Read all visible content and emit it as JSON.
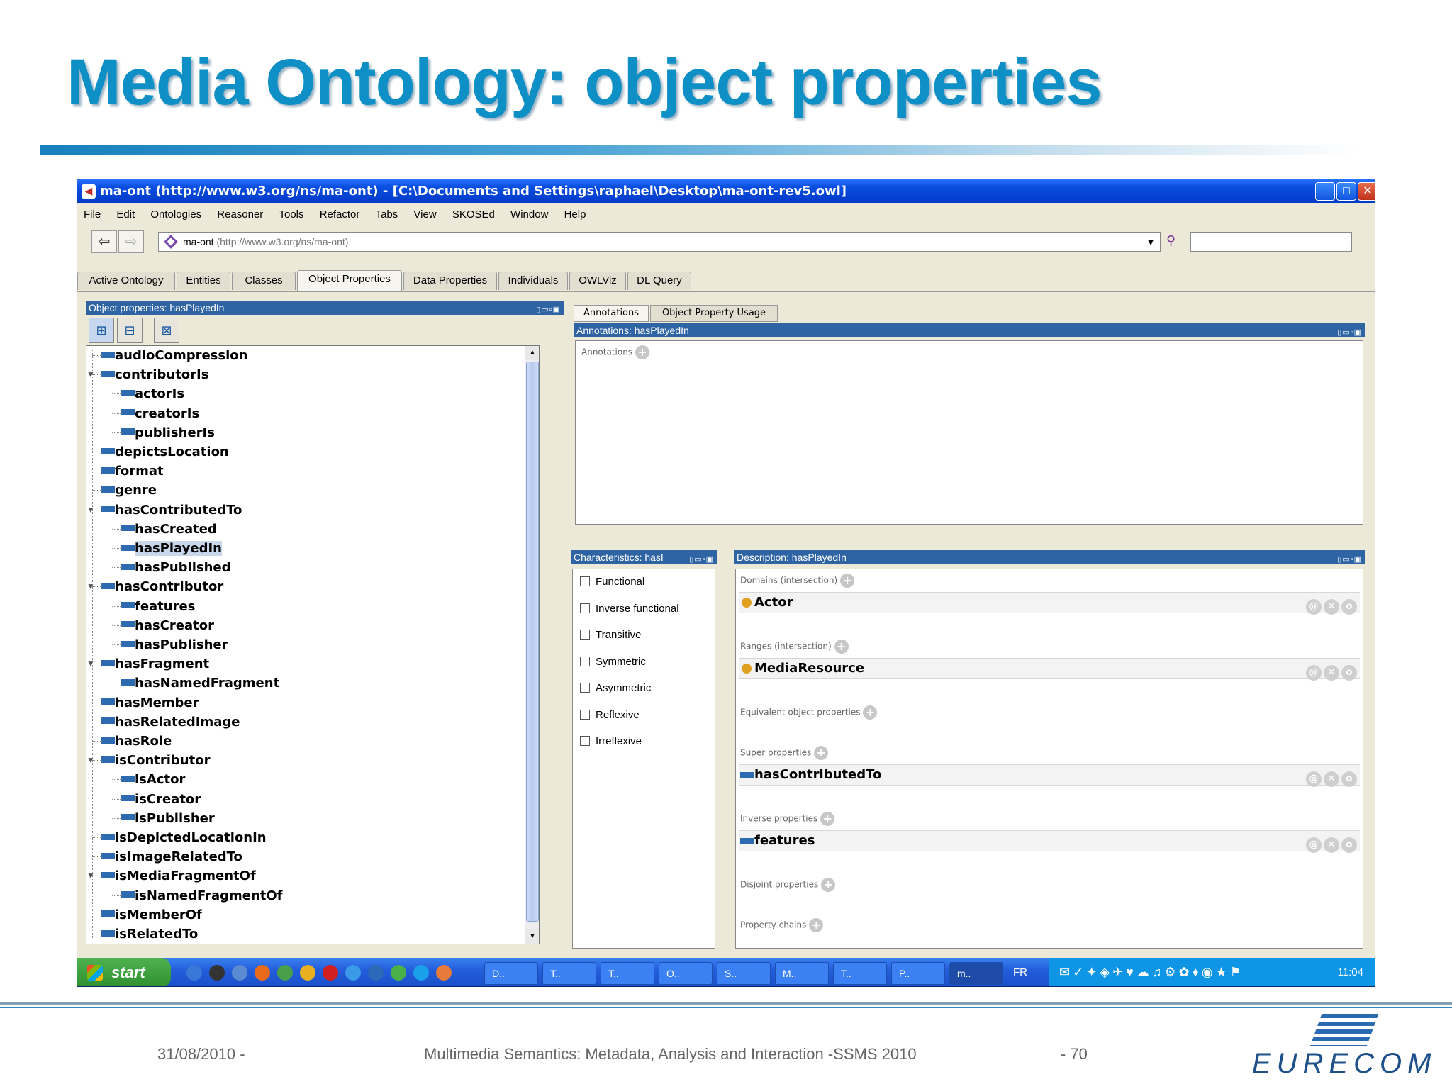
{
  "slide": {
    "title": "Media Ontology: object properties",
    "footer_date": "31/08/2010 -",
    "footer_center": "Multimedia Semantics: Metadata, Analysis and Interaction -SSMS 2010",
    "footer_page": "- 70",
    "logo_text": "EURECOM"
  },
  "window": {
    "title": "ma-ont (http://www.w3.org/ns/ma-ont) - [C:\\Documents and Settings\\raphael\\Desktop\\ma-ont-rev5.owl]"
  },
  "menu": [
    "File",
    "Edit",
    "Ontologies",
    "Reasoner",
    "Tools",
    "Refactor",
    "Tabs",
    "View",
    "SKOSEd",
    "Window",
    "Help"
  ],
  "nav": {
    "ontology_name": "ma-ont",
    "ontology_uri": "(http://www.w3.org/ns/ma-ont)"
  },
  "tabs": [
    "Active Ontology",
    "Entities",
    "Classes",
    "Object Properties",
    "Data Properties",
    "Individuals",
    "OWLViz",
    "DL Query"
  ],
  "active_tab": "Object Properties",
  "left_view": {
    "header": "Object properties: hasPlayedIn",
    "tree": [
      {
        "label": "audioCompression",
        "depth": 0,
        "expanded": false
      },
      {
        "label": "contributorIs",
        "depth": 0,
        "expanded": true
      },
      {
        "label": "actorIs",
        "depth": 1
      },
      {
        "label": "creatorIs",
        "depth": 1
      },
      {
        "label": "publisherIs",
        "depth": 1
      },
      {
        "label": "depictsLocation",
        "depth": 0
      },
      {
        "label": "format",
        "depth": 0
      },
      {
        "label": "genre",
        "depth": 0
      },
      {
        "label": "hasContributedTo",
        "depth": 0,
        "expanded": true
      },
      {
        "label": "hasCreated",
        "depth": 1
      },
      {
        "label": "hasPlayedIn",
        "depth": 1,
        "selected": true
      },
      {
        "label": "hasPublished",
        "depth": 1
      },
      {
        "label": "hasContributor",
        "depth": 0,
        "expanded": true
      },
      {
        "label": "features",
        "depth": 1
      },
      {
        "label": "hasCreator",
        "depth": 1
      },
      {
        "label": "hasPublisher",
        "depth": 1
      },
      {
        "label": "hasFragment",
        "depth": 0,
        "expanded": true
      },
      {
        "label": "hasNamedFragment",
        "depth": 1
      },
      {
        "label": "hasMember",
        "depth": 0
      },
      {
        "label": "hasRelatedImage",
        "depth": 0
      },
      {
        "label": "hasRole",
        "depth": 0
      },
      {
        "label": "isContributor",
        "depth": 0,
        "expanded": true
      },
      {
        "label": "isActor",
        "depth": 1
      },
      {
        "label": "isCreator",
        "depth": 1
      },
      {
        "label": "isPublisher",
        "depth": 1
      },
      {
        "label": "isDepictedLocationIn",
        "depth": 0
      },
      {
        "label": "isImageRelatedTo",
        "depth": 0
      },
      {
        "label": "isMediaFragmentOf",
        "depth": 0,
        "expanded": true
      },
      {
        "label": "isNamedFragmentOf",
        "depth": 1
      },
      {
        "label": "isMemberOf",
        "depth": 0
      },
      {
        "label": "isRelatedTo",
        "depth": 0
      }
    ]
  },
  "right_tabs": [
    "Annotations",
    "Object Property Usage"
  ],
  "annotations_view": {
    "header": "Annotations: hasPlayedIn",
    "section_label": "Annotations"
  },
  "characteristics_view": {
    "header": "Characteristics: hasI",
    "items": [
      "Functional",
      "Inverse functional",
      "Transitive",
      "Symmetric",
      "Asymmetric",
      "Reflexive",
      "Irreflexive"
    ]
  },
  "description_view": {
    "header": "Description: hasPlayedIn",
    "domains_label": "Domains (intersection)",
    "domain_value": "Actor",
    "ranges_label": "Ranges (intersection)",
    "range_value": "MediaResource",
    "equivalent_label": "Equivalent object properties",
    "super_label": "Super properties",
    "super_value": "hasContributedTo",
    "inverse_label": "Inverse properties",
    "inverse_value": "features",
    "disjoint_label": "Disjoint properties",
    "chains_label": "Property chains"
  },
  "taskbar": {
    "start_label": "start",
    "items": [
      "D..",
      "T..",
      "T..",
      "O..",
      "S..",
      "M..",
      "T..",
      "P..",
      "m.."
    ],
    "lang": "FR",
    "clock": "11:04"
  },
  "colors": {
    "title_blue": "#0e8fc6",
    "view_header": "#2e64a4",
    "property_icon": "#2d6ab0",
    "class_icon": "#e0a020"
  }
}
